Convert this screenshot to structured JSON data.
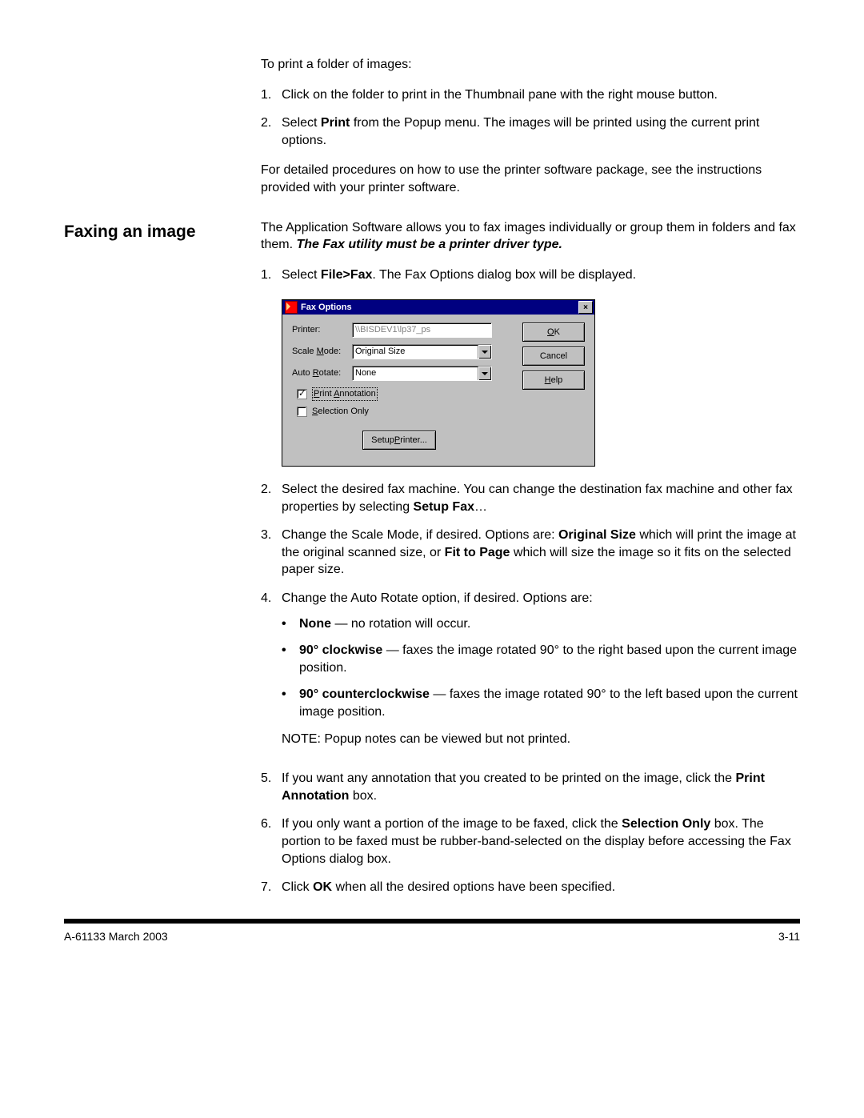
{
  "print_intro": "To print a folder of images:",
  "print_steps": [
    "Click on the folder to print in the Thumbnail pane with the right mouse button.",
    {
      "pre": "Select ",
      "b": "Print",
      "post": " from the Popup menu. The images will be printed using the current print options."
    }
  ],
  "print_detail": "For detailed procedures on how to use the printer software package, see the instructions provided with your printer software.",
  "section_heading": "Faxing an image",
  "fax_intro_pre": "The Application Software allows you to fax images individually or group them in folders and fax them. ",
  "fax_intro_bi": "The Fax utility must be a printer driver type.",
  "step1": {
    "pre": "Select ",
    "b": "File>Fax",
    "post": ".  The Fax Options dialog box will be displayed."
  },
  "dialog": {
    "title": "Fax Options",
    "printer_label": "Printer:",
    "printer_value": "\\\\BISDEV1\\lp37_ps",
    "scale_label": "Scale Mode:",
    "scale_value": "Original Size",
    "rotate_label": "Auto Rotate:",
    "rotate_value": "None",
    "print_annotation": "Print Annotation",
    "selection_only": "Selection Only",
    "setup": "Setup Printer...",
    "ok": "OK",
    "cancel": "Cancel",
    "help": "Help"
  },
  "step2": {
    "pre": "Select the desired fax machine.  You can change the destination fax machine and other fax properties by selecting ",
    "b": "Setup Fax",
    "post": "…"
  },
  "step3": {
    "pre": "Change the Scale Mode, if desired.  Options are: ",
    "b1": "Original Size",
    "mid": " which will print the image at the original scanned size, or ",
    "b2": "Fit to Page",
    "post": " which will size the image so it fits on the selected paper size."
  },
  "step4_intro": "Change the Auto Rotate option, if desired. Options are:",
  "step4_bullets": [
    {
      "b": "None",
      "post": " — no rotation will occur."
    },
    {
      "b": "90° clockwise",
      "post": " — faxes the image rotated 90° to the right based upon the current image position."
    },
    {
      "b": "90° counterclockwise",
      "post": " — faxes the image rotated 90° to the left based upon the current image position."
    }
  ],
  "note": "NOTE:  Popup notes can be viewed but not printed.",
  "step5": {
    "pre": "If you want any annotation that you created to be printed on the image, click the ",
    "b": "Print Annotation",
    "post": " box."
  },
  "step6": {
    "pre": "If you only want a portion of the image to be faxed, click the ",
    "b": "Selection Only",
    "post": " box.  The portion to be faxed must be rubber-band-selected on the display before accessing the Fax Options dialog box."
  },
  "step7": {
    "pre": "Click ",
    "b": "OK",
    "post": " when all the desired options have been specified."
  },
  "footer_left": "A-61133  March 2003",
  "footer_right": "3-11"
}
